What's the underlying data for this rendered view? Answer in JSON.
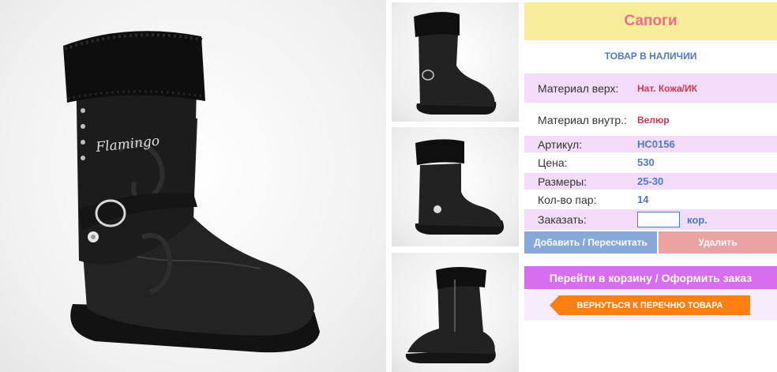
{
  "product": {
    "title": "Сапоги",
    "stock_status": "ТОВАР В НАЛИЧИИ",
    "brand_text": "Flamingo",
    "attributes": [
      {
        "label": "Материал верх:",
        "value": "Нат. Кожа/ИК"
      },
      {
        "label": "Материал внутр.:",
        "value": "Велюр"
      },
      {
        "label": "Артикул:",
        "value": "HC0156"
      },
      {
        "label": "Цена:",
        "value": "530"
      },
      {
        "label": "Размеры:",
        "value": "25-30"
      },
      {
        "label": "Кол-во пар:",
        "value": "14"
      }
    ],
    "order": {
      "label": "Заказать:",
      "value": "",
      "unit": "кор."
    }
  },
  "actions": {
    "add": "Добавить / Пересчитать",
    "delete": "Удалить",
    "cart": "Перейти в корзину / Оформить заказ",
    "back": "ВЕРНУТЬСЯ К ПЕРЕЧНЮ ТОВАРА"
  },
  "colors": {
    "title_bg": "#f9ec9d",
    "title_text": "#ef6f86",
    "accent_blue": "#4e79c9",
    "value_red": "#cc3a4a",
    "row_pink": "#f3dcf9",
    "cart_button": "#d76ef0",
    "back_button": "#ff7f11"
  }
}
